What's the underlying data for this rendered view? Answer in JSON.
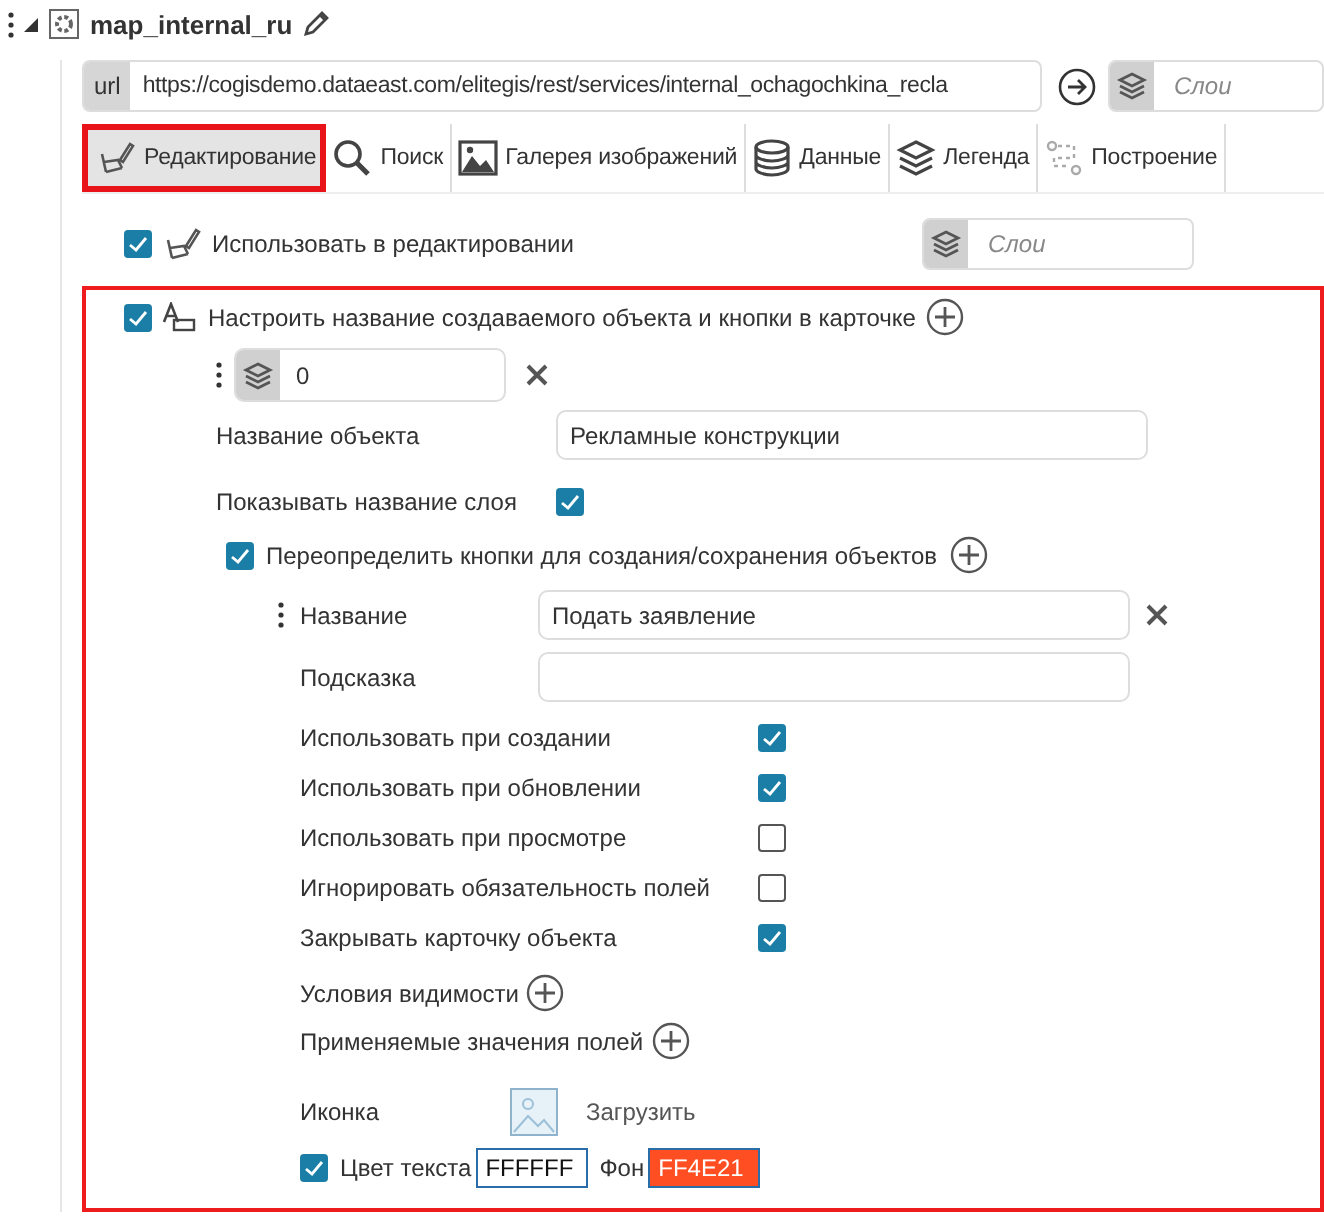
{
  "header": {
    "title": "map_internal_ru"
  },
  "url_bar": {
    "prefix": "url",
    "value": "https://cogisdemo.dataeast.com/elitegis/rest/services/internal_ochagochkina_recla",
    "layers_placeholder": "Слои"
  },
  "tabs": [
    {
      "label": "Редактирование",
      "kind": "edit",
      "selected": true,
      "highlighted": true
    },
    {
      "label": "Поиск",
      "kind": "search",
      "selected": false,
      "highlighted": false
    },
    {
      "label": "Галерея изображений",
      "kind": "gallery",
      "selected": false,
      "highlighted": false
    },
    {
      "label": "Данные",
      "kind": "data",
      "selected": false,
      "highlighted": false
    },
    {
      "label": "Легенда",
      "kind": "legend",
      "selected": false,
      "highlighted": false
    },
    {
      "label": "Построение",
      "kind": "route",
      "selected": false,
      "highlighted": false
    }
  ],
  "use_in_editing": {
    "label": "Использовать в редактировании",
    "checked": true,
    "layers_placeholder": "Слои"
  },
  "customize_section": {
    "highlighted": true,
    "label": "Настроить название создаваемого объекта и кнопки в карточке",
    "checked": true,
    "layer_index": "0",
    "object_name": {
      "label": "Название объекта",
      "value": "Рекламные конструкции"
    },
    "show_layer_name": {
      "label": "Показывать название слоя",
      "checked": true
    },
    "override_buttons": {
      "label": "Переопределить кнопки для создания/сохранения объектов",
      "checked": true
    },
    "button": {
      "name_label": "Название",
      "name_value": "Подать заявление",
      "hint_label": "Подсказка",
      "options": [
        {
          "label": "Использовать при создании",
          "checked": true
        },
        {
          "label": "Использовать при обновлении",
          "checked": true
        },
        {
          "label": "Использовать при просмотре",
          "checked": false
        },
        {
          "label": "Игнорировать обязательность полей",
          "checked": false
        },
        {
          "label": "Закрывать карточку объекта",
          "checked": true
        }
      ],
      "visibility_label": "Условия видимости",
      "values_label": "Применяемые значения полей",
      "icon_label": "Иконка",
      "upload_label": "Загрузить",
      "text_color": {
        "checked": true,
        "label": "Цвет текста",
        "value": "FFFFFF",
        "bg_label": "Фон",
        "bg_value": "FF4E21"
      }
    }
  }
}
